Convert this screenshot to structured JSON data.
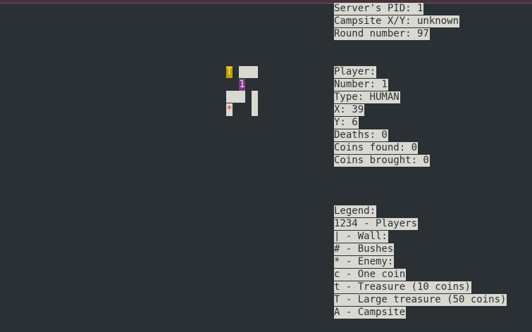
{
  "server_info": {
    "pid": "Server's PID: 1",
    "campsite": "Campsite X/Y: unknown",
    "round": "Round number: 97"
  },
  "player_info": {
    "heading": "Player:",
    "number": "Number: 1",
    "type": "Type: HUMAN",
    "x": "X: 39",
    "y": "Y: 6",
    "deaths": "Deaths: 0",
    "coins_found": "Coins found: 0",
    "coins_brought": "Coins brought: 0"
  },
  "legend": {
    "heading": "Legend:",
    "players": "1234 - Players",
    "wall": "| - Wall:",
    "bushes": "# - Bushes",
    "enemy": "* - Enemy:",
    "one_coin": "c - One coin",
    "treasure": "t - Treasure (10 coins)",
    "large_treasure": "T - Large treasure (50 coins)",
    "campsite": "A - Campsite"
  },
  "map": {
    "large_treasure_glyph": "T",
    "player_glyph": "1",
    "enemy_glyph": "*"
  },
  "colors": {
    "background": "#2b3034",
    "highlight": "#d9d9d2",
    "treasure": "#c3a000",
    "player": "#7b3a86",
    "enemy": "#e53030"
  }
}
